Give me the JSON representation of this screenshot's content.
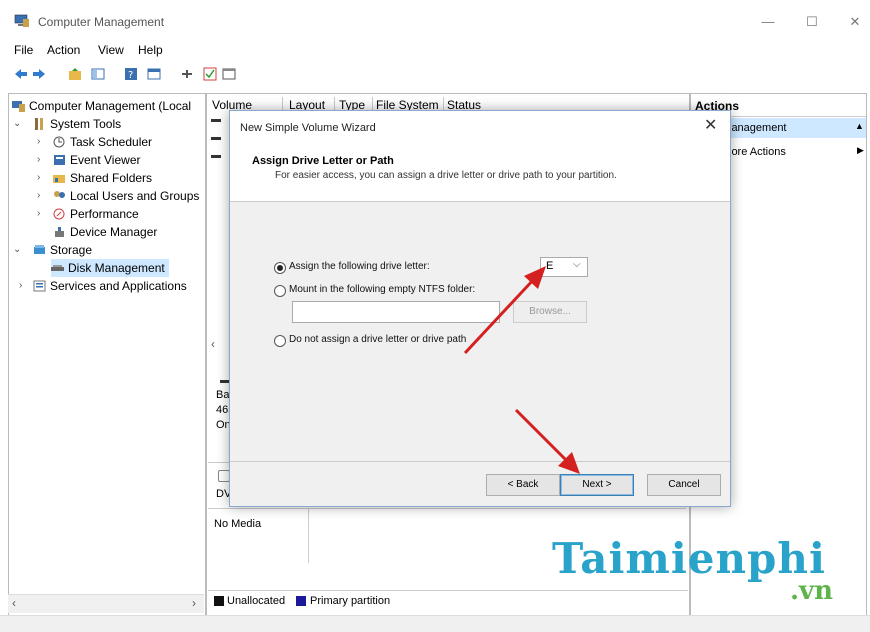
{
  "window": {
    "title": "Computer Management",
    "controls": [
      "—",
      "☐",
      "✕"
    ]
  },
  "menu": [
    "File",
    "Action",
    "View",
    "Help"
  ],
  "tree": {
    "root": "Computer Management (Local",
    "system_tools": "System Tools",
    "task_scheduler": "Task Scheduler",
    "event_viewer": "Event Viewer",
    "shared_folders": "Shared Folders",
    "local_users": "Local Users and Groups",
    "performance": "Performance",
    "device_manager": "Device Manager",
    "storage": "Storage",
    "disk_management": "Disk Management",
    "services": "Services and Applications"
  },
  "columns": [
    "Volume",
    "Layout",
    "Type",
    "File System",
    "Status"
  ],
  "disk_panel": {
    "disk0_lines": [
      "Ba",
      "465",
      "On"
    ],
    "dvd_label": "DV",
    "no_media": "No Media"
  },
  "legend": {
    "unallocated": "Unallocated",
    "primary": "Primary partition"
  },
  "actions": {
    "header": "Actions",
    "selected": "lanagement",
    "more": "lore Actions"
  },
  "dialog": {
    "title": "New Simple Volume Wizard",
    "heading": "Assign Drive Letter or Path",
    "subheading": "For easier access, you can assign a drive letter or drive path to your partition.",
    "option_letter": "Assign the following drive letter:",
    "drive_letter": "E",
    "option_folder": "Mount in the following empty NTFS folder:",
    "folder_value": "",
    "browse": "Browse...",
    "option_none": "Do not assign a drive letter or drive path",
    "back": "< Back",
    "next": "Next >",
    "cancel": "Cancel"
  },
  "watermark": {
    "brand": "Taimienphi",
    "tld": ".vn"
  },
  "colors": {
    "accent": "#3c7fb1",
    "arrow": "#d42020",
    "selection": "#cde8ff",
    "watermark_blue": "#29a3c9",
    "watermark_green": "#5fb34b"
  },
  "icons": [
    "back-arrow-icon",
    "forward-arrow-icon",
    "folder-up-icon",
    "console-tree-icon",
    "help-icon",
    "properties-icon",
    "snapin-icon",
    "checkbox-icon",
    "window-icon"
  ]
}
